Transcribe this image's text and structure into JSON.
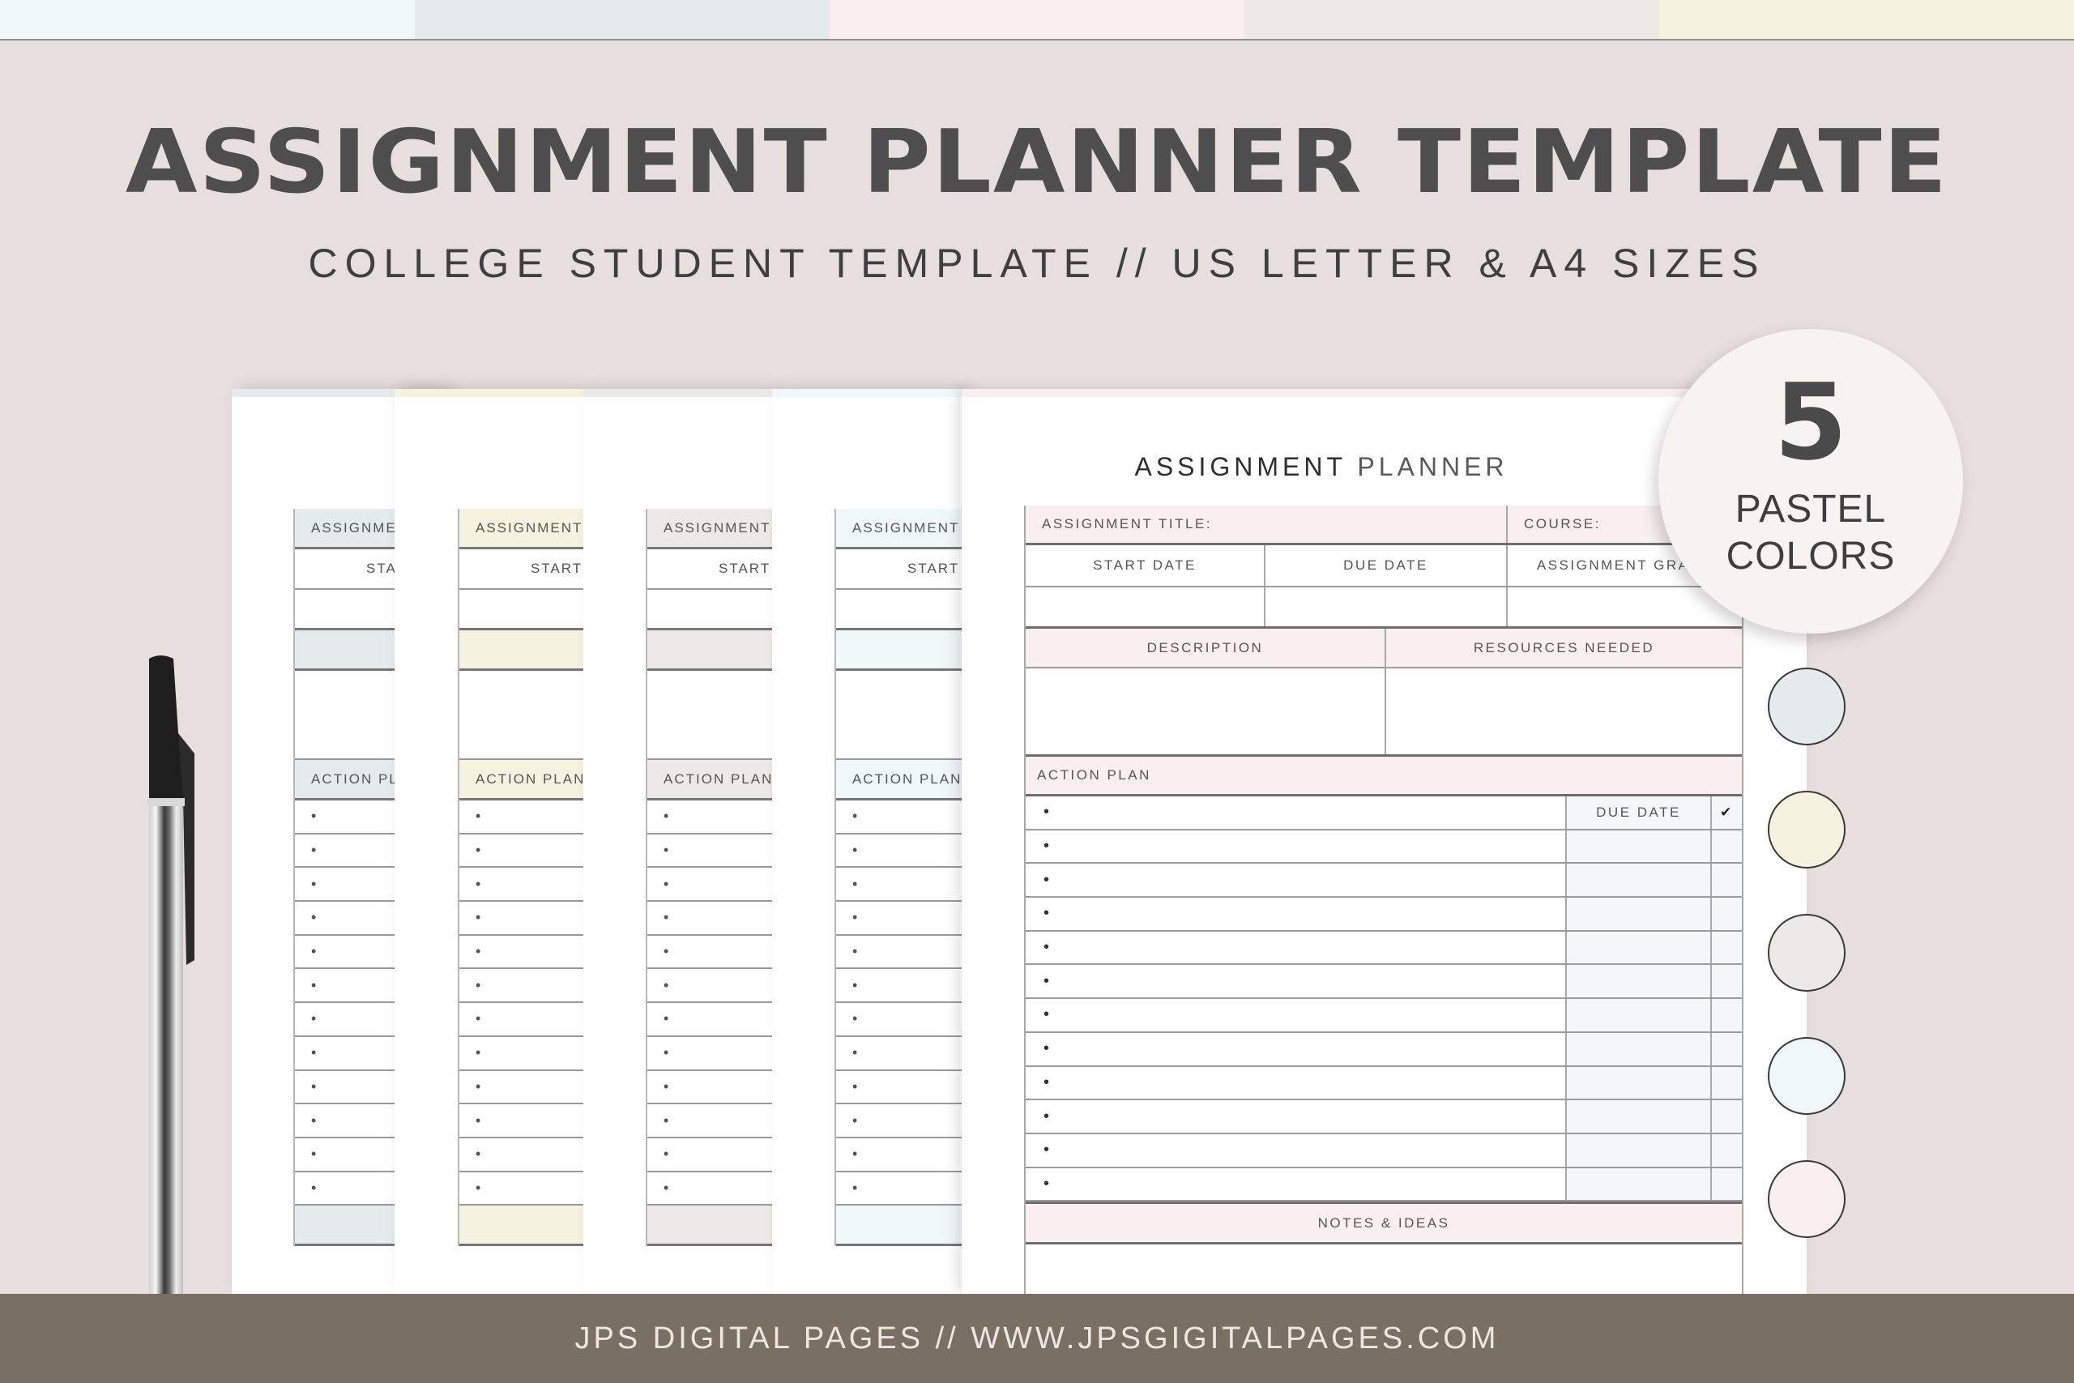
{
  "color_swatches": [
    "#eff7f9",
    "#e5eaed",
    "#f8efee",
    "#eceae6",
    "#f5f3df"
  ],
  "header": {
    "title": "ASSIGNMENT PLANNER TEMPLATE",
    "subtitle": "COLLEGE STUDENT TEMPLATE  // US LETTER & A4 SIZES"
  },
  "back_pages": [
    {
      "accent": "#e5eaed",
      "title_label": "ASSIGNMENT",
      "start_label": "START",
      "action_label": "ACTION PLAN"
    },
    {
      "accent": "#f5f3df",
      "title_label": "ASSIGNMENT",
      "start_label": "START",
      "action_label": "ACTION PLAN"
    },
    {
      "accent": "#eceae6",
      "title_label": "ASSIGNMENT",
      "start_label": "START",
      "action_label": "ACTION PLAN"
    },
    {
      "accent": "#eff7f9",
      "title_label": "ASSIGNMENT",
      "start_label": "START",
      "action_label": "ACTION PLAN"
    }
  ],
  "front_page": {
    "accent": "#f8efee",
    "heading_bold": "ASSIGNMENT",
    "heading_light": "PLANNER",
    "assignment_title_label": "ASSIGNMENT TITLE:",
    "course_label": "COURSE:",
    "start_date_label": "START DATE",
    "due_date_label": "DUE DATE",
    "grade_label": "ASSIGNMENT GRADE",
    "description_label": "DESCRIPTION",
    "resources_label": "RESOURCES NEEDED",
    "action_plan_label": "ACTION PLAN",
    "action_due_label": "DUE DATE",
    "check_glyph": "✔",
    "bullet": "•",
    "action_rows": 12,
    "notes_label": "NOTES & IDEAS"
  },
  "badge": {
    "count": "5",
    "line1": "PASTEL",
    "line2": "COLORS"
  },
  "palette": [
    "#e5eaed",
    "#f5f3df",
    "#eceae6",
    "#eff7f9",
    "#f8efee"
  ],
  "footer": {
    "text": "JPS DIGITAL PAGES // WWW.JPSGIGITALPAGES.COM"
  }
}
